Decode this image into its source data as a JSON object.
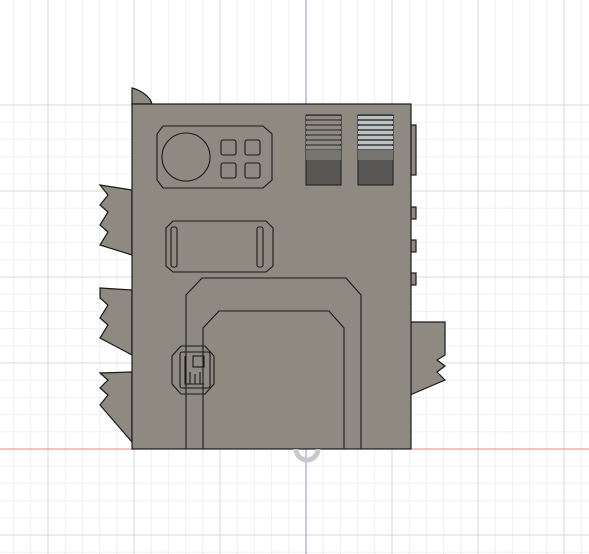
{
  "viewport": {
    "background": "#ffffff",
    "grid_minor_color": "#f0f0f0",
    "grid_major_color": "#d9d9d9",
    "axis_x_color": "#f08080",
    "axis_y_color": "#8c8cf0"
  },
  "model": {
    "body_color": "#8e8a81",
    "edge_color": "#1a1a1a",
    "shade_color": "#5a5854",
    "light_shade_color": "#b9c3c6",
    "origin_marker": "origin-pivot-icon"
  }
}
